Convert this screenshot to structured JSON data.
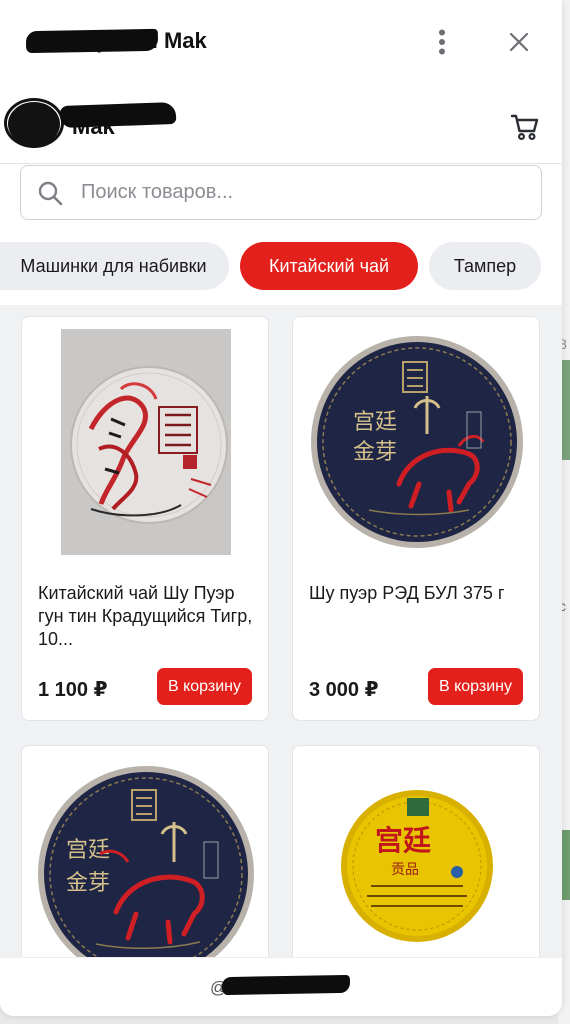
{
  "widget": {
    "app_name": "Мастерская Mak",
    "more_icon": "more-vertical-icon",
    "close_icon": "close-icon"
  },
  "shop": {
    "name": "Mak",
    "cart_icon": "cart-icon"
  },
  "search": {
    "placeholder": "Поиск товаров...",
    "value": ""
  },
  "categories": [
    {
      "label": "Машинки для набивки",
      "active": false
    },
    {
      "label": "Китайский чай",
      "active": true
    },
    {
      "label": "Тампер",
      "active": false
    }
  ],
  "products": [
    {
      "title": "Китайский чай Шу Пуэр гун тин Крадущийся Тигр, 10...",
      "price": "1 100 ₽",
      "button": "В корзину"
    },
    {
      "title": "Шу пуэр РЭД БУЛ 375 г",
      "price": "3 000 ₽",
      "button": "В корзину"
    },
    {
      "title": "",
      "price": "",
      "button": ""
    },
    {
      "title": "",
      "price": "",
      "button": ""
    }
  ],
  "footer": {
    "text": "@bot"
  },
  "colors": {
    "accent": "#e3201b",
    "chip_bg": "#ebedf0",
    "page_bg": "#f0f1f3"
  }
}
